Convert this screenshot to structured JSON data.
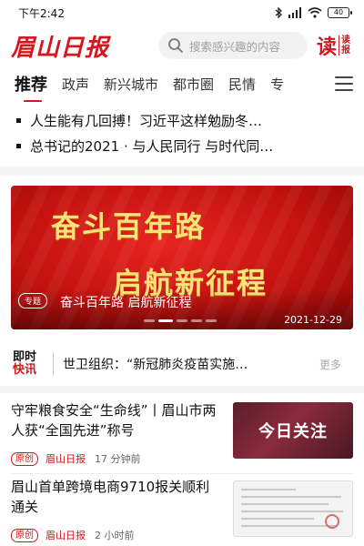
{
  "status_bar": {
    "time": "下午2:42",
    "battery": "40"
  },
  "header": {
    "logo": "眉山日报",
    "search_placeholder": "搜索感兴趣的内容",
    "read_big": "读",
    "read_small_1": "读",
    "read_small_2": "报"
  },
  "tabs": [
    {
      "label": "推荐",
      "active": true
    },
    {
      "label": "政声"
    },
    {
      "label": "新兴城市"
    },
    {
      "label": "都市圈"
    },
    {
      "label": "民情"
    },
    {
      "label": "专"
    }
  ],
  "headlines": [
    "人生能有几回搏！习近平这样勉励冬…",
    "总书记的2021 · 与人民同行 与时代同…"
  ],
  "banner": {
    "line1": "奋斗百年路",
    "line2": "启航新征程",
    "tag": "专题",
    "caption": "奋斗百年路 启航新征程",
    "date": "2021-12-29",
    "slide_count": 5,
    "active_slide": 2
  },
  "flash_news": {
    "logo_top": "即时",
    "logo_bottom": "快讯",
    "text": "世卫组织：“新冠肺炎疫苗实施…",
    "more": "更多"
  },
  "news": [
    {
      "title": "守牢粮食安全“生命线”丨眉山市两人获“全国先进”称号",
      "badge": "原创",
      "source": "眉山日报",
      "time": "17 分钟前",
      "thumb_text": "今日关注"
    },
    {
      "title": "眉山首单跨境电商9710报关顺利通关",
      "badge": "原创",
      "source": "眉山日报",
      "time": "2 小时前"
    }
  ],
  "colors": {
    "brand": "#d5161c",
    "text": "#111111",
    "muted": "#a0a0a0"
  }
}
